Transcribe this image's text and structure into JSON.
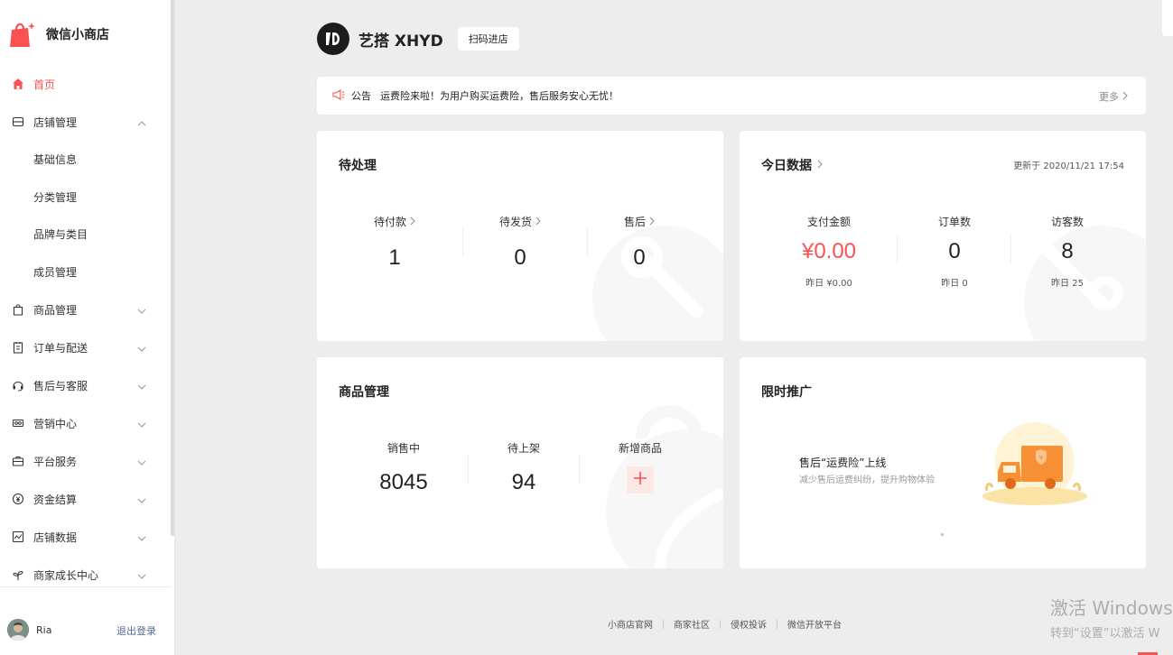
{
  "brand": {
    "name": "微信小商店",
    "accent": "#fa5151"
  },
  "sidebar": {
    "items": [
      {
        "label": "首页",
        "icon": "home-icon",
        "active": true
      },
      {
        "label": "店铺管理",
        "icon": "store-icon",
        "expanded": true,
        "children": [
          "基础信息",
          "分类管理",
          "品牌与类目",
          "成员管理"
        ]
      },
      {
        "label": "商品管理",
        "icon": "shopping-bag-icon"
      },
      {
        "label": "订单与配送",
        "icon": "clipboard-icon"
      },
      {
        "label": "售后与客服",
        "icon": "headset-icon"
      },
      {
        "label": "营销中心",
        "icon": "ticket-icon"
      },
      {
        "label": "平台服务",
        "icon": "briefcase-icon"
      },
      {
        "label": "资金结算",
        "icon": "yuan-circle-icon"
      },
      {
        "label": "店铺数据",
        "icon": "chart-icon"
      },
      {
        "label": "商家成长中心",
        "icon": "sprout-icon"
      }
    ],
    "user": {
      "name": "Ria",
      "logout": "退出登录"
    }
  },
  "shop": {
    "name": "艺搭 XHYD",
    "scan_button": "扫码进店"
  },
  "announcement": {
    "tag": "公告",
    "message": "运费险来啦！为用户购买运费险，售后服务安心无忧！",
    "more": "更多"
  },
  "pending": {
    "title": "待处理",
    "stats": [
      {
        "label": "待付款",
        "value": "1"
      },
      {
        "label": "待发货",
        "value": "0"
      },
      {
        "label": "售后",
        "value": "0"
      }
    ]
  },
  "today": {
    "title": "今日数据",
    "updated": "更新于 2020/11/21 17:54",
    "stats": [
      {
        "label": "支付金额",
        "value": "¥0.00",
        "sub": "昨日 ¥0.00",
        "highlight": true
      },
      {
        "label": "订单数",
        "value": "0",
        "sub": "昨日 0"
      },
      {
        "label": "访客数",
        "value": "8",
        "sub": "昨日 25"
      }
    ]
  },
  "products": {
    "title": "商品管理",
    "stats": [
      {
        "label": "销售中",
        "value": "8045"
      },
      {
        "label": "待上架",
        "value": "94"
      },
      {
        "label": "新增商品",
        "icon": "plus-icon"
      }
    ]
  },
  "promotion": {
    "title": "限时推广",
    "banner_title": "售后“运费险”上线",
    "banner_sub": "减少售后运费纠纷，提升购物体验"
  },
  "footer": {
    "links": [
      "小商店官网",
      "商家社区",
      "侵权投诉",
      "微信开放平台"
    ]
  },
  "system_watermark": {
    "line1": "激活 Windows",
    "line2": "转到“设置”以激活 W"
  }
}
